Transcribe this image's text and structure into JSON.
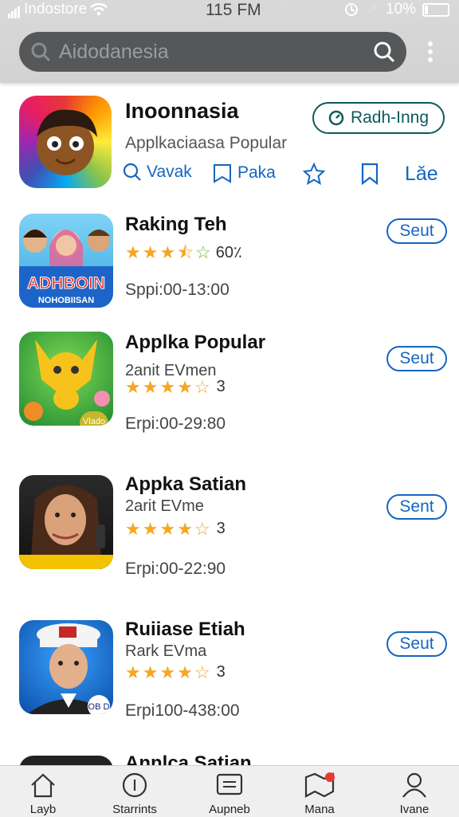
{
  "status": {
    "carrier": "Indostore",
    "time": "115 FM",
    "battery": "10%"
  },
  "search": {
    "placeholder": "Aidodanesia"
  },
  "featured": {
    "title": "Inoonnasia",
    "subtitle": "Applkaciaasa Popular",
    "button_label": "Radh-Inng",
    "actions": [
      "Vavak",
      "Paka",
      "",
      "",
      "Lǎe"
    ]
  },
  "apps": [
    {
      "name": "Raking Teh",
      "dev": "",
      "rating_text": "60٪",
      "stars": 3.5,
      "time": "Sppi:00-13:00",
      "button": "Seut",
      "icon_text": "ADHBOIN",
      "icon_sub": "NOHOBIISAN"
    },
    {
      "name": "Applka Popular",
      "dev": "2anit EVmen",
      "rating_text": "3",
      "stars": 4,
      "time": "Erpi:00-29:80",
      "button": "Seut",
      "icon_text": "Vlado"
    },
    {
      "name": "Appka Satian",
      "dev": "2arit EVme",
      "rating_text": "3",
      "stars": 4,
      "time": "Erpi:00-22:90",
      "button": "Sent"
    },
    {
      "name": "Ruiiase Etiah",
      "dev": "Rark EVma",
      "rating_text": "3",
      "stars": 4,
      "time": "Erpi100-438:00",
      "button": "Seut",
      "icon_text": "OB D"
    },
    {
      "name": "Annlca Satian",
      "dev": "",
      "rating_text": "",
      "stars": 0,
      "time": "",
      "button": ""
    }
  ],
  "bottom_nav": [
    {
      "label": "Layb",
      "icon": "home-icon"
    },
    {
      "label": "Starrints",
      "icon": "info-icon"
    },
    {
      "label": "Aupneb",
      "icon": "message-icon"
    },
    {
      "label": "Mana",
      "icon": "map-icon"
    },
    {
      "label": "Ivane",
      "icon": "profile-icon"
    }
  ],
  "colors": {
    "accent": "#1565c0",
    "star": "#f5a623",
    "header": "#d6d6d6",
    "badge": "#e53935"
  }
}
